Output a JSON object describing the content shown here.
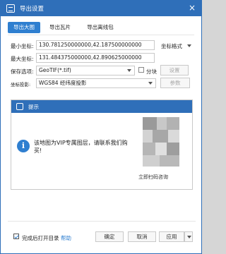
{
  "window": {
    "title": "导出设置"
  },
  "tabs": [
    {
      "label": "导出大图",
      "active": true
    },
    {
      "label": "导出瓦片",
      "active": false
    },
    {
      "label": "导出离线包",
      "active": false
    }
  ],
  "form": {
    "min_coord_label": "最小坐标:",
    "min_coord_value": "130.781250000000,42.187500000000",
    "max_coord_label": "最大坐标:",
    "max_coord_value": "131.484375000000,42.890625000000",
    "coord_format_label": "坐标格式",
    "save_type_label": "保存选项:",
    "save_type_value": "GeoTIF(*.tif)",
    "split_label": "分块",
    "settings_button": "设置",
    "projection_label": "坐标投影:",
    "projection_value": "WGS84 经纬度投影",
    "params_button": "参数"
  },
  "overlay": {
    "title": "提示",
    "message": "该地图为VIP专属图层，请联系我们购买!",
    "qr_caption": "立即扫码咨询"
  },
  "footer": {
    "open_dir_label": "完成后打开目录",
    "help_link": "帮助",
    "ok_button": "确定",
    "cancel_button": "取消",
    "apply_button": "应用"
  },
  "colors": {
    "accent": "#2f6fb9",
    "tab_active": "#2f7fd0"
  }
}
